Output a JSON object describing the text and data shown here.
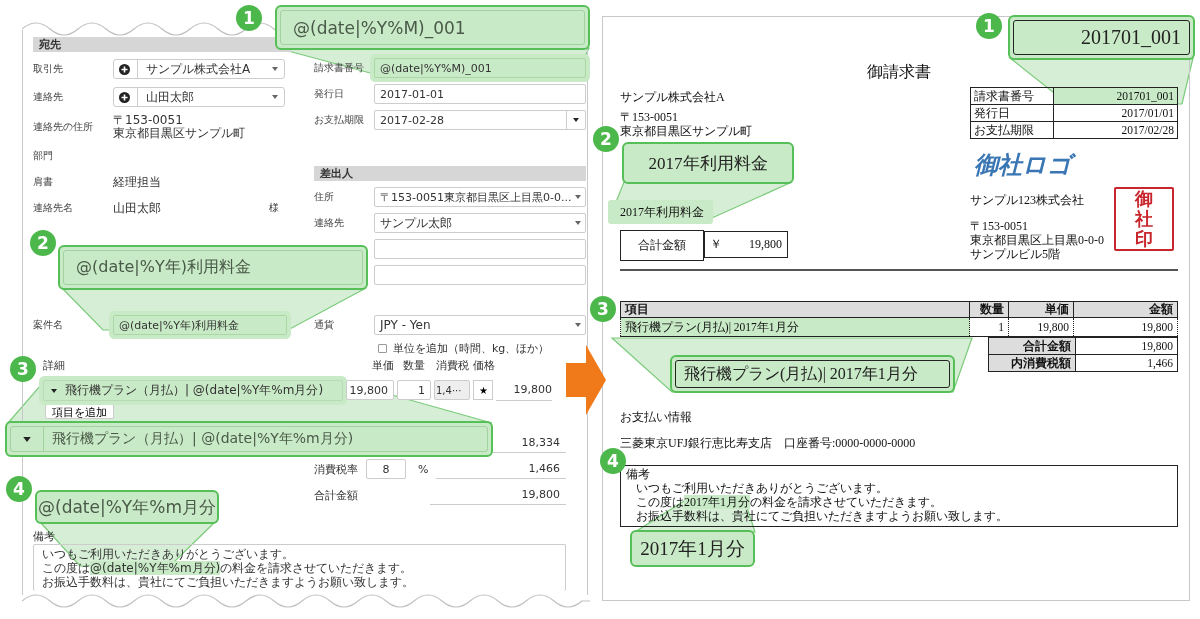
{
  "form": {
    "recipient": {
      "title": "宛先",
      "rows": [
        {
          "label": "取引先",
          "kind": "contact-select",
          "value": "サンプル株式会社A"
        },
        {
          "label": "連絡先",
          "kind": "contact-select",
          "value": "山田太郎"
        },
        {
          "label": "連絡先の住所",
          "kind": "text",
          "lines": [
            "〒153-0051",
            "東京都目黒区サンプル町"
          ]
        },
        {
          "label": "部門",
          "kind": "text"
        },
        {
          "label": "肩書",
          "kind": "text",
          "lines": [
            "経理担当"
          ]
        },
        {
          "label": "連絡先名",
          "kind": "text",
          "lines": [
            "山田太郎"
          ],
          "suffix": "様"
        }
      ]
    },
    "invoice": [
      {
        "label": "請求書番号",
        "kind": "input",
        "value": "@(date|%Y%M)_001",
        "highlighted": true
      },
      {
        "label": "発行日",
        "kind": "input",
        "value": "2017-01-01",
        "highlighted": false
      },
      {
        "label": "お支払期限",
        "kind": "date",
        "value": "2017-02-28",
        "highlighted": false
      }
    ],
    "sender": {
      "title": "差出人",
      "rows": [
        {
          "label": "住所",
          "kind": "select",
          "value": "〒153-0051東京都目黒区上目黒0-0..."
        },
        {
          "label": "連絡先",
          "kind": "select",
          "value": "サンプル太郎"
        },
        {
          "kind": "input"
        },
        {
          "kind": "input"
        }
      ]
    },
    "subject": {
      "label": "案件名",
      "value": "@(date|%Y年)利用料金",
      "highlighted": true
    },
    "currency": {
      "label": "通貨",
      "value": "JPY - Yen"
    },
    "unit_option": {
      "label": "単位を追加（時間、kg、ほか）",
      "checked": false
    },
    "details": {
      "label": "詳細",
      "columns": [
        "単価",
        "数量",
        "消費税",
        "価格"
      ],
      "rows": [
        {
          "item": "飛行機プラン（月払）| @(date|%Y年%m月分)",
          "unit_price": "19,800",
          "quantity": "1",
          "tax": "1,4···",
          "tax_mark": "★",
          "price": "19,800",
          "highlighted": true
        }
      ],
      "add_button": "項目を追加"
    },
    "totals": [
      {
        "kind": "plain",
        "value": "18,334"
      },
      {
        "kind": "rate",
        "label": "消費税率",
        "rate": "8",
        "unit": "%",
        "value": "1,466"
      },
      {
        "kind": "plain",
        "label": "合計金額",
        "value": "19,800"
      }
    ],
    "notes": {
      "label": "備考",
      "lines": [
        [
          {
            "text": "いつもご利用いただきありがとうございます。",
            "highlighted": false
          }
        ],
        [
          {
            "text": "この度は",
            "highlighted": false
          },
          {
            "text": "@(date|%Y年%m月分)",
            "highlighted": true
          },
          {
            "text": "の料金を請求させていただきます。",
            "highlighted": false
          }
        ],
        [
          {
            "text": "お振込手数料は、貴社にてご負担いただきますようお願い致します。",
            "highlighted": false
          }
        ]
      ]
    },
    "callouts": [
      {
        "number": "1",
        "text": "@(date|%Y%M)_001",
        "kind": "field"
      },
      {
        "number": "2",
        "text": "@(date|%Y年)利用料金",
        "kind": "field"
      },
      {
        "number": "3",
        "text": "飛行機プラン（月払）| @(date|%Y年%m月分)",
        "kind": "dropdown"
      },
      {
        "number": "4",
        "text": "@(date|%Y年%m月分",
        "kind": "plain"
      }
    ]
  },
  "preview": {
    "title": "御請求書",
    "client": "サンプル株式会社A",
    "client_address": [
      "〒153-0051",
      "東京都目黒区サンプル町"
    ],
    "subject": {
      "text": "2017年利用料金",
      "highlighted": true
    },
    "total": {
      "label": "合計金額",
      "currency": "￥",
      "value": "19,800"
    },
    "meta": [
      {
        "label": "請求書番号",
        "value": "201701_001",
        "highlighted": true
      },
      {
        "label": "発行日",
        "value": "2017/01/01",
        "highlighted": false
      },
      {
        "label": "お支払期限",
        "value": "2017/02/28",
        "highlighted": false
      }
    ],
    "logo": "御社ロゴ",
    "sender": {
      "name": "サンプル123株式会社",
      "address": [
        "〒153-0051",
        "東京都目黒区上目黒0-0-0",
        "サンプルビル5階"
      ]
    },
    "seal": "御社印",
    "items": {
      "columns": [
        "項目",
        "数量",
        "単価",
        "金額"
      ],
      "rows": [
        {
          "cells": [
            "飛行機プラン(月払)| 2017年1月分",
            "1",
            "19,800",
            "19,800"
          ],
          "highlighted": true
        }
      ],
      "totals": [
        {
          "label": "合計金額",
          "value": "19,800"
        },
        {
          "label": "内消費税額",
          "value": "1,466"
        }
      ]
    },
    "payment": {
      "title": "お支払い情報",
      "text": "三菱東京UFJ銀行恵比寿支店　口座番号:0000-0000-0000"
    },
    "notes": {
      "title": "備考",
      "lines": [
        [
          {
            "text": "いつもご利用いただきありがとうございます。",
            "highlighted": false
          }
        ],
        [
          {
            "text": "この度は",
            "highlighted": false
          },
          {
            "text": "2017年1月分",
            "highlighted": true
          },
          {
            "text": "の料金を請求させていただきます。",
            "highlighted": false
          }
        ],
        [
          {
            "text": "お振込手数料は、貴社にてご負担いただきますようお願い致します。",
            "highlighted": false
          }
        ]
      ]
    },
    "callouts": [
      {
        "number": "1",
        "text": "201701_001",
        "kind": "cell"
      },
      {
        "number": "2",
        "text": "2017年利用料金",
        "kind": "plain"
      },
      {
        "number": "3",
        "text": "飛行機プラン(月払)| 2017年1月分",
        "kind": "cell"
      },
      {
        "number": "4",
        "text": "2017年1月分",
        "kind": "plain"
      }
    ]
  }
}
